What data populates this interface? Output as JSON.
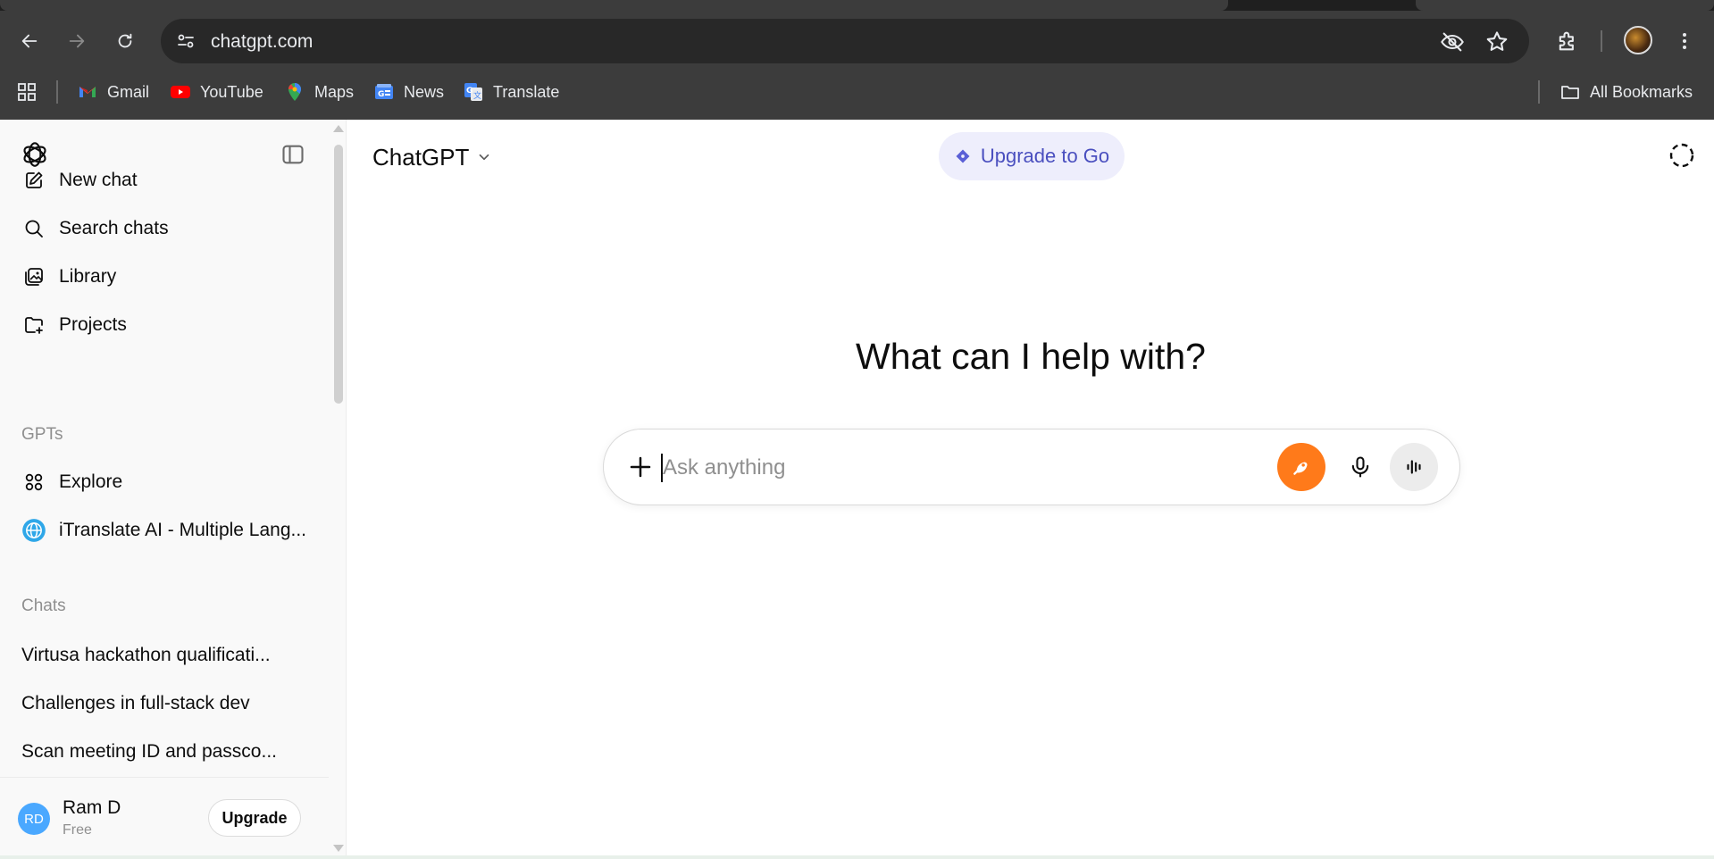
{
  "browser": {
    "url": "chatgpt.com",
    "bookmarks": [
      {
        "label": "Gmail",
        "icon": "gmail-icon"
      },
      {
        "label": "YouTube",
        "icon": "youtube-icon"
      },
      {
        "label": "Maps",
        "icon": "maps-icon"
      },
      {
        "label": "News",
        "icon": "news-icon"
      },
      {
        "label": "Translate",
        "icon": "translate-icon"
      }
    ],
    "all_bookmarks_label": "All Bookmarks"
  },
  "sidebar": {
    "nav": [
      {
        "label": "New chat",
        "icon": "compose-icon"
      },
      {
        "label": "Search chats",
        "icon": "search-icon"
      },
      {
        "label": "Library",
        "icon": "library-icon"
      },
      {
        "label": "Projects",
        "icon": "folder-plus-icon"
      }
    ],
    "gpts_heading": "GPTs",
    "gpts": [
      {
        "label": "Explore",
        "icon": "grid-icon"
      },
      {
        "label": "iTranslate AI - Multiple Lang...",
        "icon": "globe-icon"
      }
    ],
    "chats_heading": "Chats",
    "chats": [
      "Virtusa hackathon qualificati...",
      "Challenges in full-stack dev",
      "Scan meeting ID and passco..."
    ],
    "user": {
      "initials": "RD",
      "name": "Ram D",
      "plan": "Free",
      "upgrade_label": "Upgrade"
    }
  },
  "main": {
    "model_label": "ChatGPT",
    "upgrade_pill_label": "Upgrade to Go",
    "headline": "What can I help with?",
    "composer_placeholder": "Ask anything"
  },
  "colors": {
    "chrome_dark": "#3c3c3c",
    "accent_orange": "#ff7a1a",
    "upgrade_pill_bg": "#eeeefc",
    "upgrade_pill_text": "#4a4fbf",
    "avatar_blue": "#4aa8ff"
  }
}
